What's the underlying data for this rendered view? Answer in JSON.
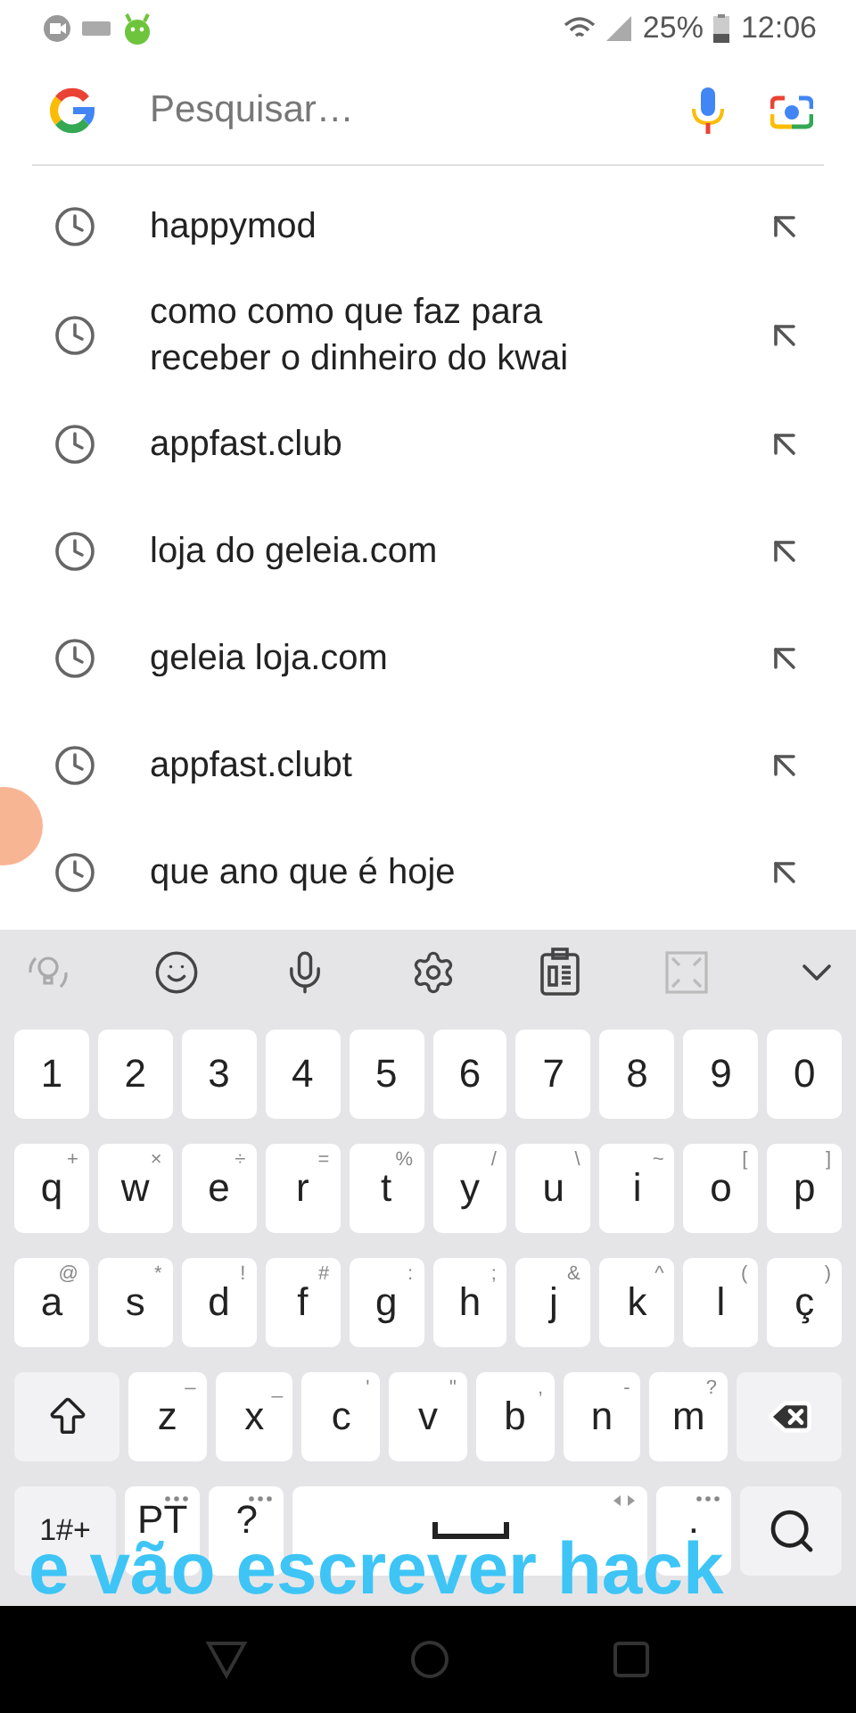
{
  "status_bar": {
    "battery": "25%",
    "time": "12:06"
  },
  "search": {
    "placeholder": "Pesquisar…"
  },
  "suggestions": [
    {
      "text": "happymod"
    },
    {
      "text": "como como que faz para receber o dinheiro do kwai"
    },
    {
      "text": "appfast.club"
    },
    {
      "text": "loja do geleia.com"
    },
    {
      "text": "geleia loja.com"
    },
    {
      "text": "appfast.clubt"
    },
    {
      "text": "que ano que é hoje"
    }
  ],
  "keyboard": {
    "rows": [
      {
        "keys": [
          {
            "kind": "char",
            "label": "1"
          },
          {
            "kind": "char",
            "label": "2"
          },
          {
            "kind": "char",
            "label": "3"
          },
          {
            "kind": "char",
            "label": "4"
          },
          {
            "kind": "char",
            "label": "5"
          },
          {
            "kind": "char",
            "label": "6"
          },
          {
            "kind": "char",
            "label": "7"
          },
          {
            "kind": "char",
            "label": "8"
          },
          {
            "kind": "char",
            "label": "9"
          },
          {
            "kind": "char",
            "label": "0"
          }
        ]
      },
      {
        "keys": [
          {
            "kind": "char",
            "label": "q",
            "hint": "+"
          },
          {
            "kind": "char",
            "label": "w",
            "hint": "×"
          },
          {
            "kind": "char",
            "label": "e",
            "hint": "÷"
          },
          {
            "kind": "char",
            "label": "r",
            "hint": "="
          },
          {
            "kind": "char",
            "label": "t",
            "hint": "%"
          },
          {
            "kind": "char",
            "label": "y",
            "hint": "/"
          },
          {
            "kind": "char",
            "label": "u",
            "hint": "\\"
          },
          {
            "kind": "char",
            "label": "i",
            "hint": "~"
          },
          {
            "kind": "char",
            "label": "o",
            "hint": "["
          },
          {
            "kind": "char",
            "label": "p",
            "hint": "]"
          }
        ]
      },
      {
        "keys": [
          {
            "kind": "char",
            "label": "a",
            "hint": "@"
          },
          {
            "kind": "char",
            "label": "s",
            "hint": "*"
          },
          {
            "kind": "char",
            "label": "d",
            "hint": "!"
          },
          {
            "kind": "char",
            "label": "f",
            "hint": "#"
          },
          {
            "kind": "char",
            "label": "g",
            "hint": ":"
          },
          {
            "kind": "char",
            "label": "h",
            "hint": ";"
          },
          {
            "kind": "char",
            "label": "j",
            "hint": "&"
          },
          {
            "kind": "char",
            "label": "k",
            "hint": "^"
          },
          {
            "kind": "char",
            "label": "l",
            "hint": "("
          },
          {
            "kind": "char",
            "label": "ç",
            "hint": ")"
          }
        ]
      },
      {
        "keys": [
          {
            "kind": "shift"
          },
          {
            "kind": "char",
            "label": "z",
            "hint": "–"
          },
          {
            "kind": "char",
            "label": "x",
            "hint": "_"
          },
          {
            "kind": "char",
            "label": "c",
            "hint": "'"
          },
          {
            "kind": "char",
            "label": "v",
            "hint": "\""
          },
          {
            "kind": "char",
            "label": "b",
            "hint": ","
          },
          {
            "kind": "char",
            "label": "n",
            "hint": "-"
          },
          {
            "kind": "char",
            "label": "m",
            "hint": "?"
          },
          {
            "kind": "backspace"
          }
        ]
      },
      {
        "keys": [
          {
            "kind": "symbols",
            "label": "1#+"
          },
          {
            "kind": "char",
            "label": "PT",
            "more": true
          },
          {
            "kind": "char",
            "label": "?",
            "more": true
          },
          {
            "kind": "space"
          },
          {
            "kind": "char",
            "label": ".",
            "more": true
          },
          {
            "kind": "search"
          }
        ]
      }
    ]
  },
  "caption": "e vão escrever hack"
}
